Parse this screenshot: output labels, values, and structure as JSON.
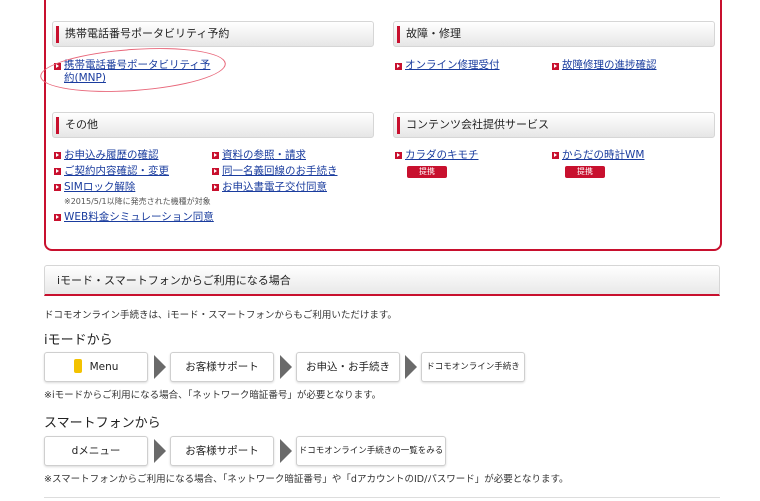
{
  "mnp": {
    "heading": "携帯電話番号ポータビリティ予約",
    "link": "携帯電話番号ポータビリティ予約(MNP)"
  },
  "repair": {
    "heading": "故障・修理",
    "links": [
      "オンライン修理受付",
      "故障修理の進捗確認"
    ]
  },
  "other": {
    "heading": "その他",
    "links": [
      "お申込み履歴の確認",
      "ご契約内容確認・変更",
      "SIMロック解除",
      "WEB料金シミュレーション同意",
      "資料の参照・請求",
      "同一名義回線のお手続き",
      "お申込書電子交付同意"
    ],
    "sim_note": "※2015/5/1以降に発売された機種が対象"
  },
  "contents": {
    "heading": "コンテンツ会社提供サービス",
    "links": [
      "カラダのキモチ",
      "からだの時計WM"
    ],
    "badge": "提携"
  },
  "imode_section": {
    "heading": "iモード・スマートフォンからご利用になる場合",
    "intro": "ドコモオンライン手続きは、iモード・スマートフォンからもご利用いただけます。",
    "imode_title": "iモードから",
    "imode_steps": [
      "Menu",
      "お客様サポート",
      "お申込・お手続き",
      "ドコモオンライン手続き"
    ],
    "imode_note": "※iモードからご利用になる場合、「ネットワーク暗証番号」が必要となります。",
    "smart_title": "スマートフォンから",
    "smart_steps": [
      "dメニュー",
      "お客様サポート",
      "ドコモオンライン手続きの一覧をみる"
    ],
    "smart_note": "※スマートフォンからご利用になる場合、「ネットワーク暗証番号」や「dアカウントのID/パスワード」が必要となります。"
  },
  "colors": {
    "accent": "#c8102e",
    "link": "#1a3c9e",
    "circle": "#e8677a"
  }
}
